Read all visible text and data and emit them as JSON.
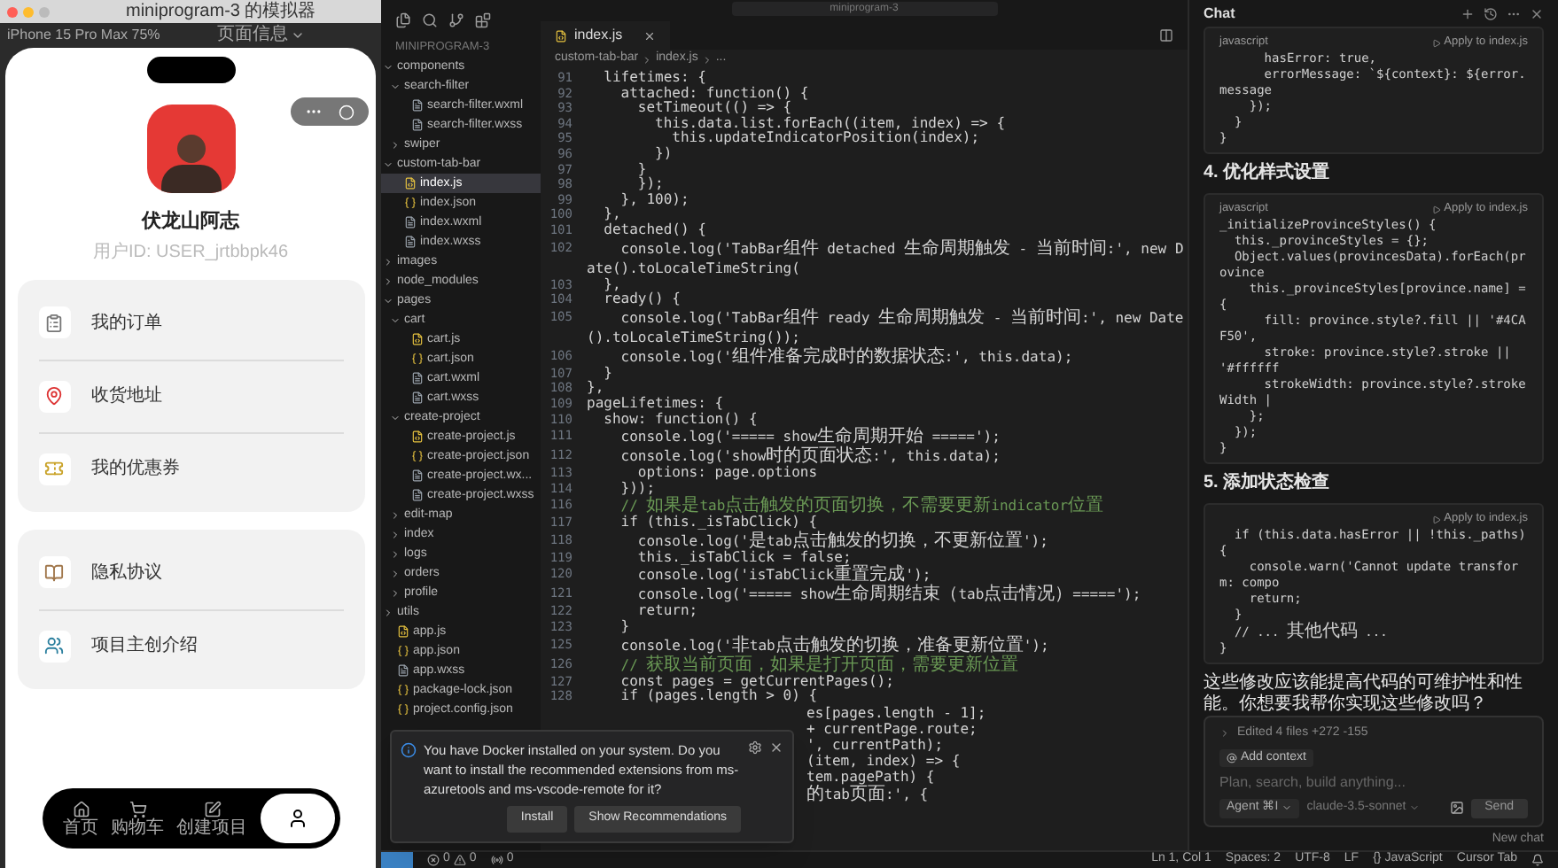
{
  "simulator": {
    "title": "miniprogram-3 的模拟器",
    "device": "iPhone 15 Pro Max 75%",
    "page_info": "页面信息",
    "profile": {
      "name": "伏龙山阿志",
      "user_id": "用户ID: USER_jrtbbpk46"
    },
    "menu_groups": [
      {
        "items": [
          {
            "label": "我的订单"
          },
          {
            "label": "收货地址"
          },
          {
            "label": "我的优惠券"
          }
        ]
      },
      {
        "items": [
          {
            "label": "隐私协议"
          },
          {
            "label": "项目主创介绍"
          }
        ]
      }
    ],
    "tab_bar": [
      {
        "label": "首页",
        "selected": false
      },
      {
        "label": "购物车",
        "selected": false
      },
      {
        "label": "创建项目",
        "selected": false
      },
      {
        "selected": true
      }
    ]
  },
  "explorer": {
    "header": "MINIPROGRAM-3",
    "tree": [
      {
        "name": "components",
        "kind": "folder",
        "expanded": true,
        "selected": false,
        "children": [
          {
            "name": "search-filter",
            "kind": "folder",
            "expanded": true,
            "selected": false,
            "children": [
              {
                "name": "search-filter.wxml",
                "kind": "markup",
                "selected": false
              },
              {
                "name": "search-filter.wxss",
                "kind": "markup",
                "selected": false
              }
            ]
          },
          {
            "name": "swiper",
            "kind": "folder",
            "expanded": false,
            "selected": false
          }
        ]
      },
      {
        "name": "custom-tab-bar",
        "kind": "folder",
        "expanded": true,
        "selected": false,
        "children": [
          {
            "name": "index.js",
            "kind": "js",
            "selected": true
          },
          {
            "name": "index.json",
            "kind": "json",
            "selected": false
          },
          {
            "name": "index.wxml",
            "kind": "markup",
            "selected": false
          },
          {
            "name": "index.wxss",
            "kind": "markup",
            "selected": false
          }
        ]
      },
      {
        "name": "images",
        "kind": "folder",
        "expanded": false,
        "selected": false
      },
      {
        "name": "node_modules",
        "kind": "folder",
        "expanded": false,
        "selected": false
      },
      {
        "name": "pages",
        "kind": "folder",
        "expanded": true,
        "selected": false,
        "children": [
          {
            "name": "cart",
            "kind": "folder",
            "expanded": true,
            "selected": false,
            "children": [
              {
                "name": "cart.js",
                "kind": "js",
                "selected": false
              },
              {
                "name": "cart.json",
                "kind": "json",
                "selected": false
              },
              {
                "name": "cart.wxml",
                "kind": "markup",
                "selected": false
              },
              {
                "name": "cart.wxss",
                "kind": "markup",
                "selected": false
              }
            ]
          },
          {
            "name": "create-project",
            "kind": "folder",
            "expanded": true,
            "selected": false,
            "children": [
              {
                "name": "create-project.js",
                "kind": "js",
                "selected": false
              },
              {
                "name": "create-project.json",
                "kind": "json",
                "selected": false
              },
              {
                "name": "create-project.wx...",
                "kind": "markup",
                "selected": false
              },
              {
                "name": "create-project.wxss",
                "kind": "markup",
                "selected": false
              }
            ]
          },
          {
            "name": "edit-map",
            "kind": "folder",
            "expanded": false,
            "selected": false
          },
          {
            "name": "index",
            "kind": "folder",
            "expanded": false,
            "selected": false
          },
          {
            "name": "logs",
            "kind": "folder",
            "expanded": false,
            "selected": false
          },
          {
            "name": "orders",
            "kind": "folder",
            "expanded": false,
            "selected": false
          },
          {
            "name": "profile",
            "kind": "folder",
            "expanded": false,
            "selected": false
          }
        ]
      },
      {
        "name": "utils",
        "kind": "folder",
        "expanded": false,
        "selected": false
      },
      {
        "name": "app.js",
        "kind": "js",
        "selected": false
      },
      {
        "name": "app.json",
        "kind": "json",
        "selected": false
      },
      {
        "name": "app.wxss",
        "kind": "markup",
        "selected": false
      },
      {
        "name": "package-lock.json",
        "kind": "json",
        "selected": false
      },
      {
        "name": "project.config.json",
        "kind": "json",
        "selected": false
      }
    ]
  },
  "editor": {
    "search": "miniprogram-3",
    "tab": "index.js",
    "breadcrumb": [
      "custom-tab-bar",
      "index.js",
      "..."
    ],
    "lines": [
      {
        "num": "91",
        "kind": "code",
        "text": "  lifetimes: {"
      },
      {
        "num": "92",
        "kind": "code",
        "text": "    attached: function() {"
      },
      {
        "num": "93",
        "kind": "code",
        "text": "      setTimeout(() => {"
      },
      {
        "num": "94",
        "kind": "code",
        "text": "        this.data.list.forEach((item, index) => {"
      },
      {
        "num": "95",
        "kind": "code",
        "text": "          this.updateIndicatorPosition(index);"
      },
      {
        "num": "96",
        "kind": "code",
        "text": "        })"
      },
      {
        "num": "97",
        "kind": "code",
        "text": "      }"
      },
      {
        "num": "98",
        "kind": "code",
        "text": "      });"
      },
      {
        "num": "99",
        "kind": "code",
        "text": "    }, 100);"
      },
      {
        "num": "100",
        "kind": "code",
        "text": "  },"
      },
      {
        "num": "101",
        "kind": "code",
        "text": "  detached() {"
      },
      {
        "num": "102",
        "kind": "code",
        "text": "    console.log('TabBar组件 detached 生命周期触发 - 当前时间:', new Date().toLocaleTimeString("
      },
      {
        "num": "103",
        "kind": "code",
        "text": "  },"
      },
      {
        "num": "104",
        "kind": "code",
        "text": "  ready() {"
      },
      {
        "num": "105",
        "kind": "code",
        "text": "    console.log('TabBar组件 ready 生命周期触发 - 当前时间:', new Date().toLocaleTimeString());"
      },
      {
        "num": "106",
        "kind": "code",
        "text": "    console.log('组件准备完成时的数据状态:', this.data);"
      },
      {
        "num": "107",
        "kind": "code",
        "text": "  }"
      },
      {
        "num": "108",
        "kind": "code",
        "text": "},"
      },
      {
        "num": "109",
        "kind": "code",
        "text": "pageLifetimes: {"
      },
      {
        "num": "110",
        "kind": "code",
        "text": "  show: function() {"
      },
      {
        "num": "111",
        "kind": "code",
        "text": "    console.log('===== show生命周期开始 =====');"
      },
      {
        "num": "112",
        "kind": "code",
        "text": "    console.log('show时的页面状态:', this.data);"
      },
      {
        "num": "113",
        "kind": "code",
        "text": "      options: page.options"
      },
      {
        "num": "114",
        "kind": "code",
        "text": "    }));"
      },
      {
        "num": "116",
        "kind": "comment",
        "text": "    // 如果是tab点击触发的页面切换，不需要更新indicator位置"
      },
      {
        "num": "117",
        "kind": "code",
        "text": "    if (this._isTabClick) {"
      },
      {
        "num": "118",
        "kind": "code",
        "text": "      console.log('是tab点击触发的切换，不更新位置');"
      },
      {
        "num": "119",
        "kind": "code",
        "text": "      this._isTabClick = false;"
      },
      {
        "num": "120",
        "kind": "code",
        "text": "      console.log('isTabClick重置完成');"
      },
      {
        "num": "121",
        "kind": "code",
        "text": "      console.log('===== show生命周期结束（tab点击情况）=====');"
      },
      {
        "num": "122",
        "kind": "code",
        "text": "      return;"
      },
      {
        "num": "123",
        "kind": "code",
        "text": "    }"
      },
      {
        "num": "125",
        "kind": "code",
        "text": "    console.log('非tab点击触发的切换，准备更新位置');"
      },
      {
        "num": "126",
        "kind": "comment",
        "text": "    // 获取当前页面，如果是打开页面，需要更新位置"
      },
      {
        "num": "127",
        "kind": "code",
        "text": "    const pages = getCurrentPages();"
      },
      {
        "num": "128",
        "kind": "code",
        "text": "    if (pages.length > 0) {"
      },
      {
        "kind": "tail",
        "text": "es[pages.length - 1];"
      },
      {
        "kind": "tail",
        "text": "+ currentPage.route;"
      },
      {
        "kind": "tail",
        "text": "', currentPath);"
      },
      {
        "kind": "tail",
        "text": "(item, index) => {"
      },
      {
        "kind": "tail",
        "text": "tem.pagePath) {"
      },
      {
        "kind": "tail",
        "text": "的tab页面:', {"
      }
    ]
  },
  "notification": {
    "message": "You have Docker installed on your system. Do you want to install the recommended extensions from ms-azuretools and ms-vscode-remote for it?",
    "buttons": [
      "Install",
      "Show Recommendations"
    ]
  },
  "chat": {
    "title": "Chat",
    "blocks": [
      {
        "kind": "code",
        "language": "javascript",
        "apply": "Apply to index.js",
        "lines": [
          "      hasError: true,",
          "      errorMessage: `${context}: ${error.message",
          "    });",
          "  }",
          "}"
        ]
      },
      {
        "kind": "heading",
        "text": "4. 优化样式设置"
      },
      {
        "kind": "code",
        "language": "javascript",
        "apply": "Apply to index.js",
        "lines": [
          "_initializeProvinceStyles() {",
          "  this._provinceStyles = {};",
          "  Object.values(provincesData).forEach(province",
          "    this._provinceStyles[province.name] = {",
          "      fill: province.style?.fill || '#4CAF50',",
          "      stroke: province.style?.stroke || '#ffffff",
          "      strokeWidth: province.style?.strokeWidth |",
          "    };",
          "  });",
          "}"
        ]
      },
      {
        "kind": "heading",
        "text": "5. 添加状态检查"
      },
      {
        "kind": "code",
        "apply": "Apply to index.js",
        "lines": [
          "  if (this.data.hasError || !this._paths) {",
          "    console.warn('Cannot update transform: compo",
          "    return;",
          "  }",
          "  // ... 其他代码 ...",
          "}"
        ]
      },
      {
        "kind": "paragraph",
        "text": "这些修改应该能提高代码的可维护性和性能。你想要我帮你实现这些修改吗？"
      }
    ],
    "edited": "Edited 4 files +272 -155",
    "add_context": "Add context",
    "placeholder": "Plan, search, build anything...",
    "mode": "Agent ⌘I",
    "model": "claude-3.5-sonnet",
    "send": "Send",
    "new_chat": "New chat"
  },
  "status_bar": {
    "errors": "0",
    "warnings": "0",
    "ports": "0",
    "items": [
      "Ln 1, Col 1",
      "Spaces: 2",
      "UTF-8",
      "LF",
      "{} JavaScript",
      "Cursor Tab"
    ]
  }
}
